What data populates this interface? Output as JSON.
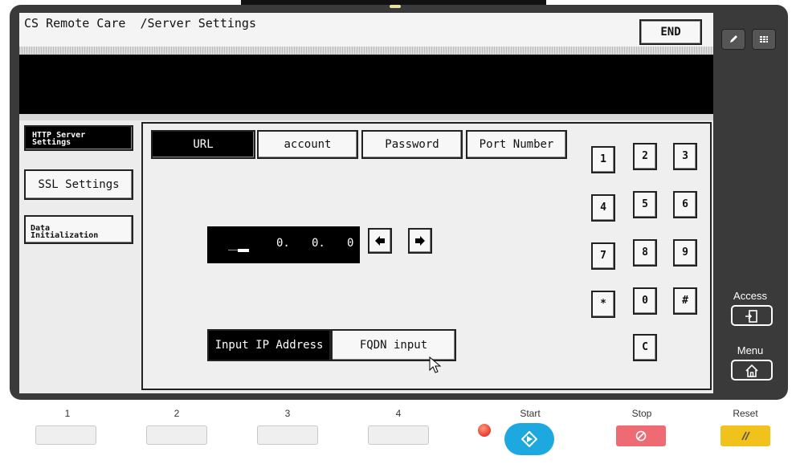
{
  "header": {
    "title": "CS Remote Care  /Server Settings",
    "end_label": "END"
  },
  "side_tabs": [
    {
      "label_line1": "HTTP Server",
      "label_line2": "Settings"
    },
    {
      "label": "SSL Settings"
    },
    {
      "label_line1": "Data",
      "label_line2": "Initialization"
    }
  ],
  "tabs": [
    "URL",
    "account",
    "Password",
    "Port Number"
  ],
  "ip": {
    "octet1": "___",
    "octet2": "0.",
    "octet3": "0.",
    "octet4": "0"
  },
  "arrows": {
    "left": "◆",
    "right": "➤"
  },
  "modes": {
    "ip_label": "Input IP Address",
    "fqdn_label": "FQDN input"
  },
  "keypad": [
    "1",
    "2",
    "3",
    "4",
    "5",
    "6",
    "7",
    "8",
    "9",
    "*",
    "0",
    "#",
    "C"
  ],
  "right_panel": {
    "access_label": "Access",
    "menu_label": "Menu"
  },
  "hardware": {
    "buttons": [
      "1",
      "2",
      "3",
      "4"
    ],
    "start_label": "Start",
    "stop_label": "Stop",
    "reset_label": "Reset"
  },
  "colors": {
    "start": "#1ea8e0",
    "stop": "#ee6b73",
    "reset": "#f0c21b",
    "led": "#dd1111"
  }
}
